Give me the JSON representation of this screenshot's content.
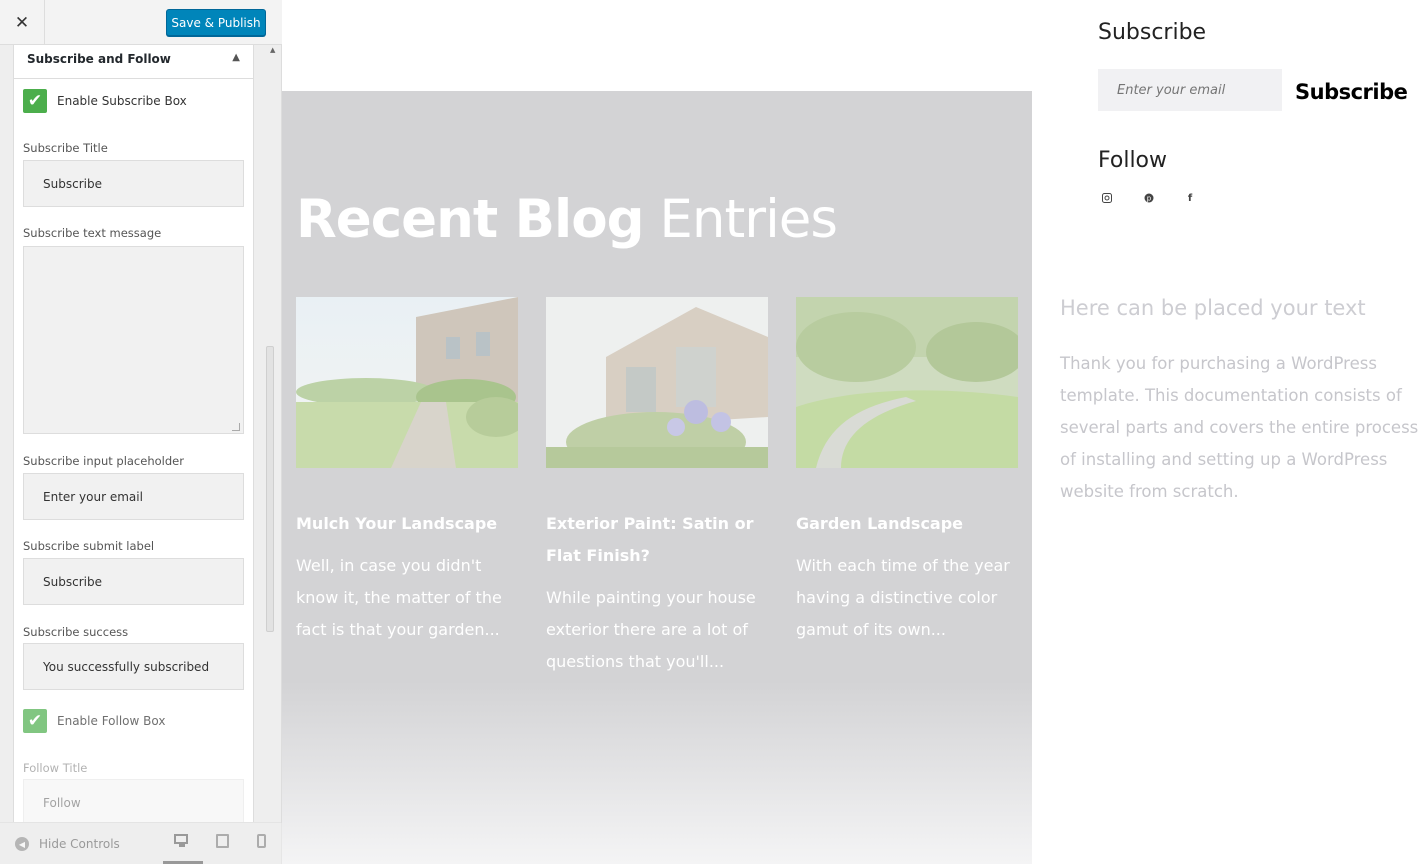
{
  "sidebar": {
    "close_glyph": "✕",
    "save_label": "Save & Publish",
    "section_title": "Subscribe and Follow",
    "section_arrow": "▲",
    "enable_subscribe_label": "Enable Subscribe Box",
    "enable_subscribe_checked": true,
    "fields": {
      "subscribe_title_label": "Subscribe Title",
      "subscribe_title_value": "Subscribe",
      "subscribe_text_label": "Subscribe text message",
      "subscribe_text_value": "",
      "placeholder_label": "Subscribe input placeholder",
      "placeholder_value": "Enter your email",
      "submit_label_label": "Subscribe submit label",
      "submit_label_value": "Subscribe",
      "success_label": "Subscribe success",
      "success_value": "You successfully subscribed"
    },
    "enable_follow_label": "Enable Follow Box",
    "enable_follow_checked": true,
    "follow_title_label": "Follow Title",
    "follow_title_value": "Follow",
    "footer": {
      "hide_controls_label": "Hide Controls",
      "active_device": "desktop"
    }
  },
  "preview": {
    "heading_bold": "Recent Blog",
    "heading_light": "Entries",
    "posts": [
      {
        "title": "Mulch Your Landscape",
        "excerpt": "Well, in case you didn't know it, the matter of the fact is that your garden..."
      },
      {
        "title": "Exterior Paint: Satin or Flat Finish?",
        "excerpt": "While painting your house exterior there are a lot of questions that you'll..."
      },
      {
        "title": "Garden Landscape",
        "excerpt": "With each time of the year having a distinctive color gamut of its own..."
      }
    ],
    "subscribe_widget": {
      "title": "Subscribe",
      "input_placeholder": "Enter your email",
      "button_label": "Subscribe"
    },
    "follow_widget": {
      "title": "Follow",
      "icons": [
        "instagram-icon",
        "pinterest-icon",
        "facebook-icon"
      ]
    },
    "text_widget": {
      "title": "Here can be placed your text",
      "body": "Thank you for purchasing a WordPress template. This documentation consists of several parts and covers the entire process of installing and setting up a WordPress website from scratch."
    }
  },
  "colors": {
    "primary_button": "#0085ba",
    "checkbox_green": "#4cae4c",
    "blog_bg": "#d3d3d5"
  }
}
